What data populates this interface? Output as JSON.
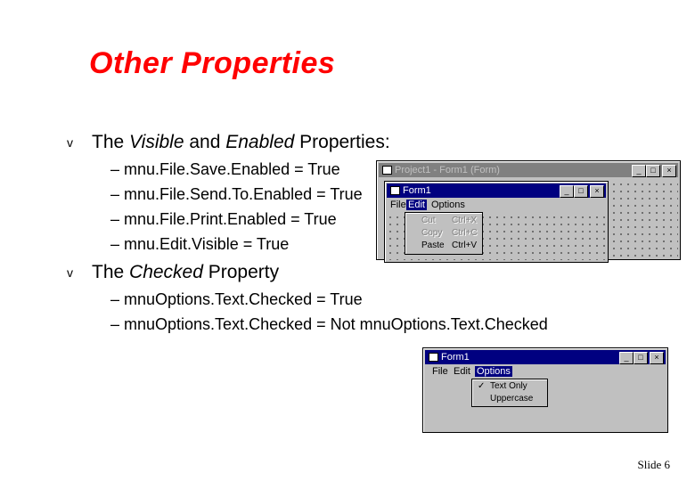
{
  "slide": {
    "title": "Other Properties",
    "slide_number": "Slide 6"
  },
  "bullets": [
    {
      "mark": "v",
      "parts": [
        "The ",
        "Visible",
        " and ",
        "Enabled",
        " Properties:"
      ],
      "subitems": [
        "– mnu.File.Save.Enabled = True",
        "– mnu.File.Send.To.Enabled = True",
        "– mnu.File.Print.Enabled = True",
        "– mnu.Edit.Visible = True"
      ]
    },
    {
      "mark": "v",
      "parts": [
        "The ",
        "Checked",
        " Property"
      ],
      "subitems": [
        "– mnuOptions.Text.Checked = True",
        "– mnuOptions.Text.Checked = Not mnuOptions.Text.Checked"
      ]
    }
  ],
  "screenshot1": {
    "outer_title": "Project1 - Form1 (Form)",
    "inner_title": "Form1",
    "menu": [
      "File",
      "Edit",
      "Options"
    ],
    "dropdown": [
      {
        "label": "Cut",
        "shortcut": "Ctrl+X",
        "state": "disabled"
      },
      {
        "label": "Copy",
        "shortcut": "Ctrl+C",
        "state": "disabled"
      },
      {
        "label": "Paste",
        "shortcut": "Ctrl+V",
        "state": "enabled"
      }
    ],
    "buttons": [
      "_",
      "□",
      "×"
    ]
  },
  "screenshot2": {
    "title": "Form1",
    "menu": [
      "File",
      "Edit",
      "Options"
    ],
    "dropdown": [
      {
        "label": "Text Only",
        "checked": true
      },
      {
        "label": "Uppercase",
        "checked": false
      }
    ],
    "check_mark": "✓",
    "buttons": [
      "_",
      "□",
      "×"
    ]
  }
}
